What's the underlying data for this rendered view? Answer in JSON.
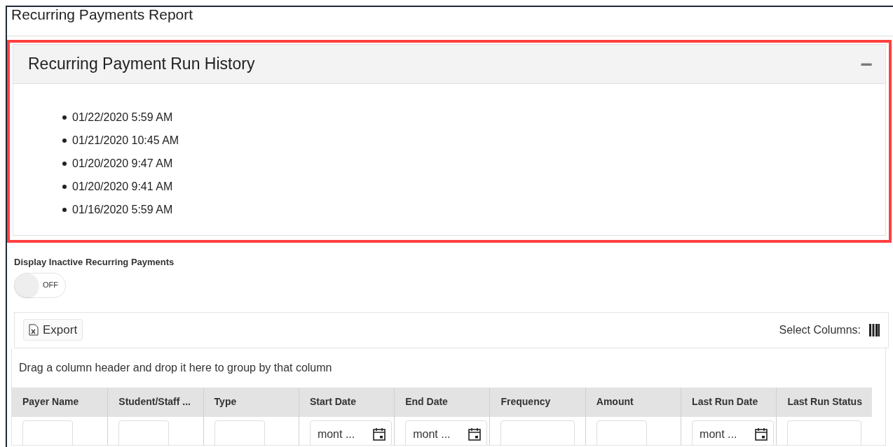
{
  "page_title": "Recurring Payments Report",
  "run_history": {
    "title": "Recurring Payment Run History",
    "collapse_icon": "−",
    "highlighted": true,
    "items": [
      "01/22/2020 5:59 AM",
      "01/21/2020 10:45 AM",
      "01/20/2020 9:47 AM",
      "01/20/2020 9:41 AM",
      "01/16/2020 5:59 AM"
    ]
  },
  "inactive_toggle": {
    "label": "Display Inactive Recurring Payments",
    "on": false,
    "state_text": "OFF"
  },
  "toolbar": {
    "export_label": "Export",
    "select_columns_label": "Select Columns:"
  },
  "group_hint": "Drag a column header and drop it here to group by that column",
  "table": {
    "columns": [
      {
        "label": "Payer Name",
        "filter": {
          "kind": "text"
        }
      },
      {
        "label": "Student/Staff ...",
        "filter": {
          "kind": "text"
        }
      },
      {
        "label": "Type",
        "filter": {
          "kind": "text"
        }
      },
      {
        "label": "Start Date",
        "filter": {
          "kind": "date",
          "placeholder": "mont ..."
        }
      },
      {
        "label": "End Date",
        "filter": {
          "kind": "date",
          "placeholder": "mont ..."
        }
      },
      {
        "label": "Frequency",
        "filter": {
          "kind": "text",
          "wide": true
        }
      },
      {
        "label": "Amount",
        "filter": {
          "kind": "text"
        }
      },
      {
        "label": "Last Run Date",
        "filter": {
          "kind": "date",
          "placeholder": "mont ..."
        }
      },
      {
        "label": "Last Run Status",
        "filter": {
          "kind": "text",
          "wide": true
        }
      }
    ]
  }
}
